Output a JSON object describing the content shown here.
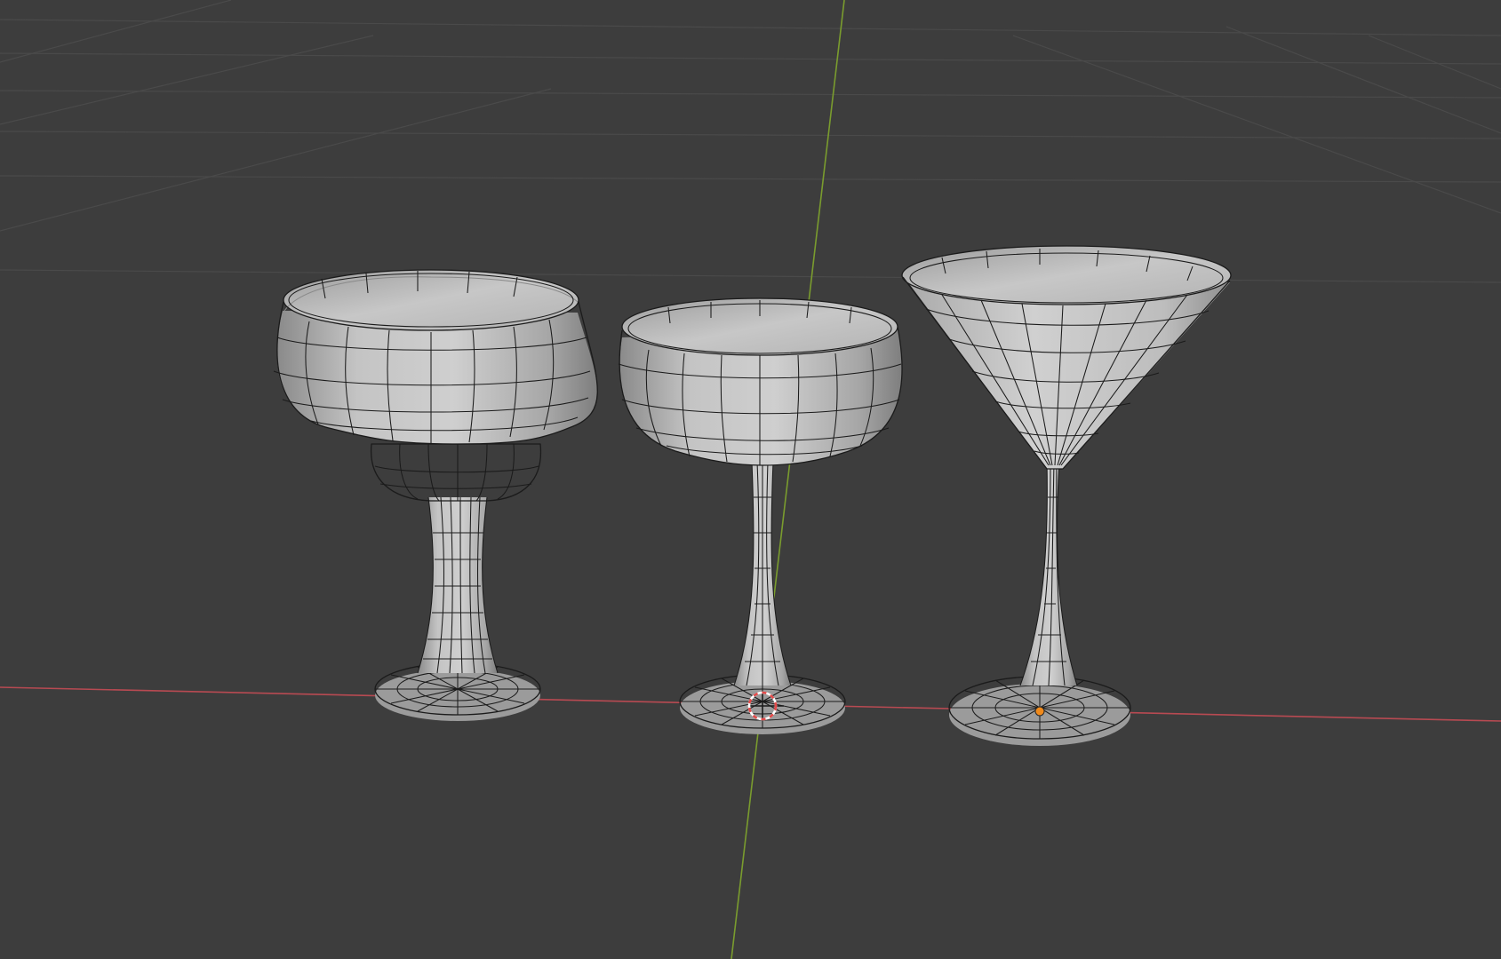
{
  "viewport": {
    "background_color": "#3d3d3d",
    "grid_color": "#4a4a4a",
    "x_axis_color": "#b84a52",
    "y_axis_color": "#7a9c2e",
    "mesh_surface_color": "#bdbdbd",
    "wire_color": "#1b1b1b",
    "origin_color": "#f08a1c",
    "cursor_colors": [
      "#e44a4a",
      "#ffffff"
    ]
  },
  "objects": [
    {
      "name": "margarita-glass",
      "kind": "glass mesh",
      "selected": false
    },
    {
      "name": "coupe-glass",
      "kind": "glass mesh",
      "selected": false
    },
    {
      "name": "martini-glass",
      "kind": "glass mesh",
      "selected": true
    }
  ],
  "scene_items": {
    "cursor_icon": "3d-cursor-icon",
    "origin_icon": "object-origin-dot"
  }
}
